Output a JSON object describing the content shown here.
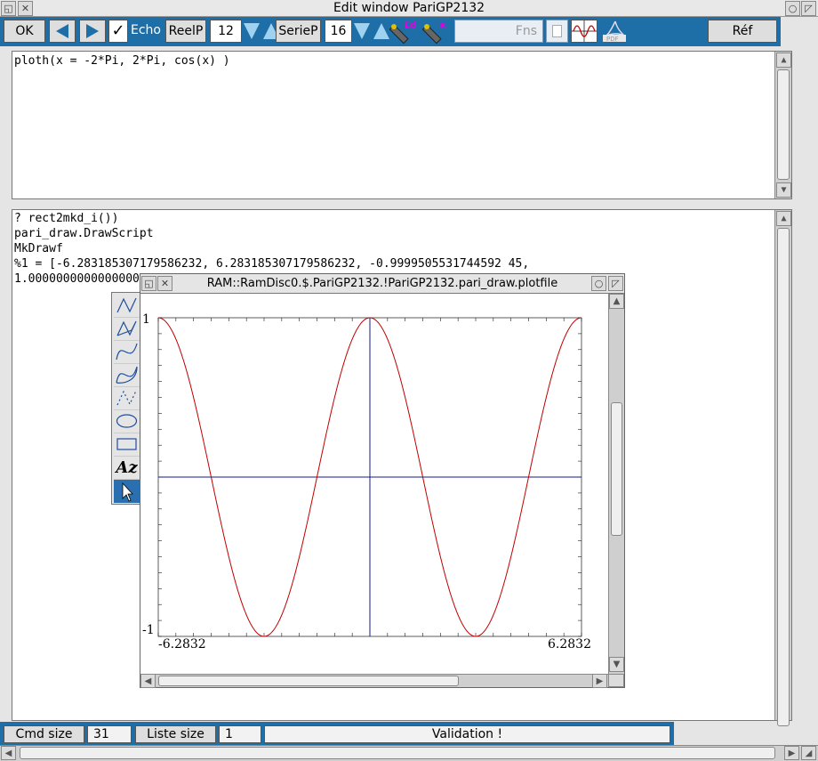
{
  "window": {
    "title": "Edit window PariGP2132"
  },
  "toolbar": {
    "ok_label": "OK",
    "echo_label": "Echo",
    "echo_checked": true,
    "reelp_label": "ReelP",
    "reelp_value": "12",
    "seriep_label": "SerieP",
    "seriep_value": "16",
    "fns_placeholder": "Fns",
    "ref_label": "Réf",
    "pdf_label": "PDF"
  },
  "command_pane": {
    "text": "ploth(x = -2*Pi, 2*Pi, cos(x) )"
  },
  "output_pane": {
    "lines": [
      "? rect2mkd_i())",
      "pari_draw.DrawScript",
      "MkDrawf",
      "%1 = [-6.283185307179586232, 6.283185307179586232, -0.9999505531744592 45,",
      "1.000000000000000000000]"
    ]
  },
  "plot_window": {
    "title": "RAM::RamDisc0.$.PariGP2132.!PariGP2132.pari_draw.plotfile",
    "ymax_label": "1",
    "ymin_label": "-1",
    "xmin_label": "-6.2832",
    "xmax_label": "6.2832"
  },
  "chart_data": {
    "type": "line",
    "function": "cos(x)",
    "x_range": [
      -6.2832,
      6.2832
    ],
    "y_range": [
      -1,
      1
    ],
    "series": [
      {
        "color": "#c00000"
      }
    ],
    "axes_color": "#1a1a8a",
    "grid": false
  },
  "palette": {
    "tools": [
      "polyline-icon",
      "polygon-icon",
      "curve-icon",
      "closed-curve-icon",
      "dotted-line-icon",
      "ellipse-icon",
      "rectangle-icon",
      "text-icon",
      "select-arrow-icon"
    ],
    "text_tool_label": "Az"
  },
  "statusbar": {
    "cmd_size_label": "Cmd size",
    "cmd_size_value": "31",
    "liste_size_label": "Liste size",
    "liste_size_value": "1",
    "message": "Validation !"
  }
}
